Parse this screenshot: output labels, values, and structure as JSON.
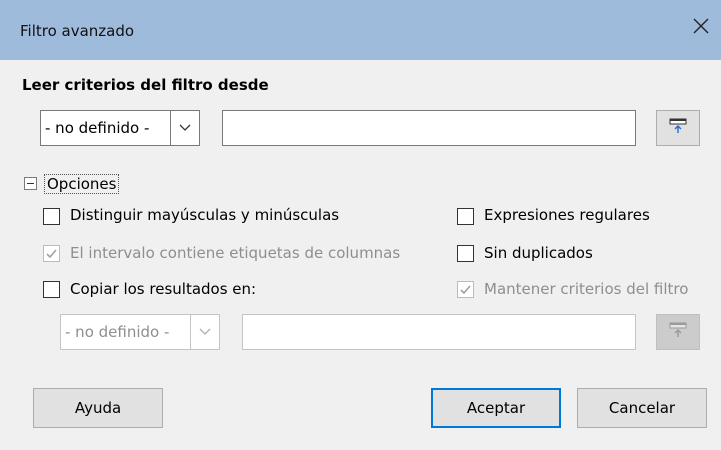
{
  "title": "Filtro avanzado",
  "section_title": "Leer criterios del filtro desde",
  "source": {
    "dropdown_value": "- no definido -",
    "text_value": ""
  },
  "options_label": "Opciones",
  "options": {
    "case_sensitive": {
      "label": "Distinguir mayúsculas y minúsculas",
      "checked": false,
      "enabled": true
    },
    "range_has_headers": {
      "label": "El intervalo contiene etiquetas de columnas",
      "checked": true,
      "enabled": false
    },
    "copy_results": {
      "label": "Copiar los resultados en:",
      "checked": false,
      "enabled": true
    },
    "regex": {
      "label": "Expresiones regulares",
      "checked": false,
      "enabled": true
    },
    "no_duplicates": {
      "label": "Sin duplicados",
      "checked": false,
      "enabled": true
    },
    "keep_criteria": {
      "label": "Mantener criterios del filtro",
      "checked": true,
      "enabled": false
    }
  },
  "copy_target": {
    "dropdown_value": "- no definido -",
    "text_value": ""
  },
  "buttons": {
    "help": "Ayuda",
    "ok": "Aceptar",
    "cancel": "Cancelar"
  }
}
